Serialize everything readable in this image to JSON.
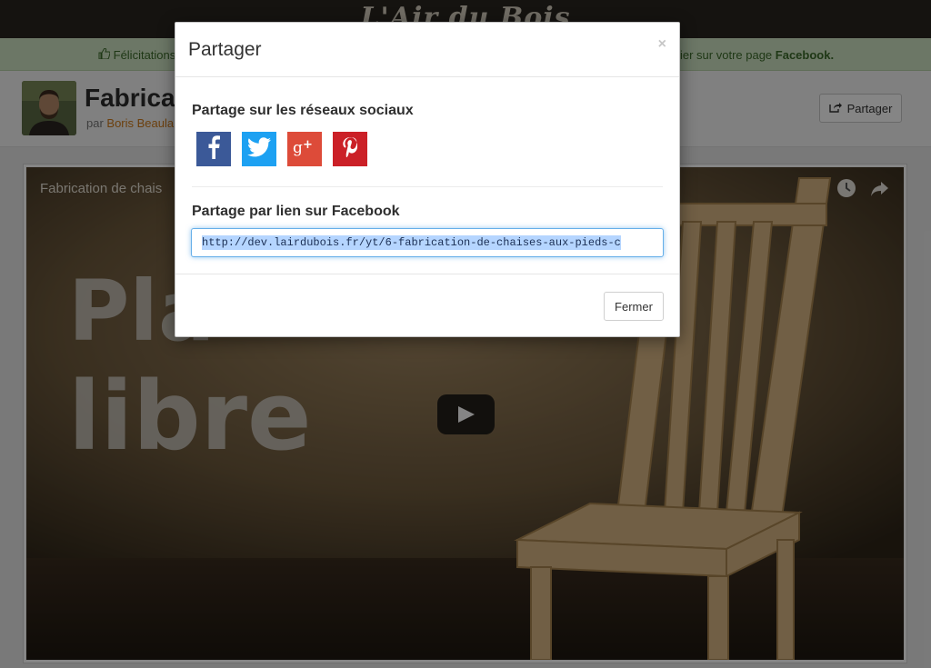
{
  "site": {
    "logo": "L'Air du Bois"
  },
  "notice": {
    "left_text": "Félicitations",
    "right_text": "ier sur votre page ",
    "right_bold": "Facebook."
  },
  "video": {
    "title_partial": "Fabrica",
    "byline_prefix": "par ",
    "author_partial": "Boris Beaula",
    "share_label": "Partager",
    "player_title": "Fabrication de chais",
    "overlay_text_top": "Pla",
    "overlay_text_bottom": "libre"
  },
  "modal": {
    "title": "Partager",
    "close_glyph": "×",
    "social_heading": "Partage sur les réseaux sociaux",
    "social_buttons": [
      {
        "name": "facebook",
        "color": "#3b5998",
        "glyph": "f"
      },
      {
        "name": "twitter",
        "color": "#1da1f2",
        "glyph": "twitter-bird"
      },
      {
        "name": "google-plus",
        "color": "#dd4b39",
        "glyph": "g+"
      },
      {
        "name": "pinterest",
        "color": "#cb2027",
        "glyph": "p"
      }
    ],
    "link_heading": "Partage par lien sur Facebook",
    "link_value": "http://dev.lairdubois.fr/yt/6-fabrication-de-chaises-aux-pieds-c",
    "close_button_label": "Fermer"
  },
  "colors": {
    "topbar": "#2a2620",
    "notice_bg": "#cfe5c3",
    "link_accent": "#d07a19",
    "input_focus": "#66afe9"
  }
}
